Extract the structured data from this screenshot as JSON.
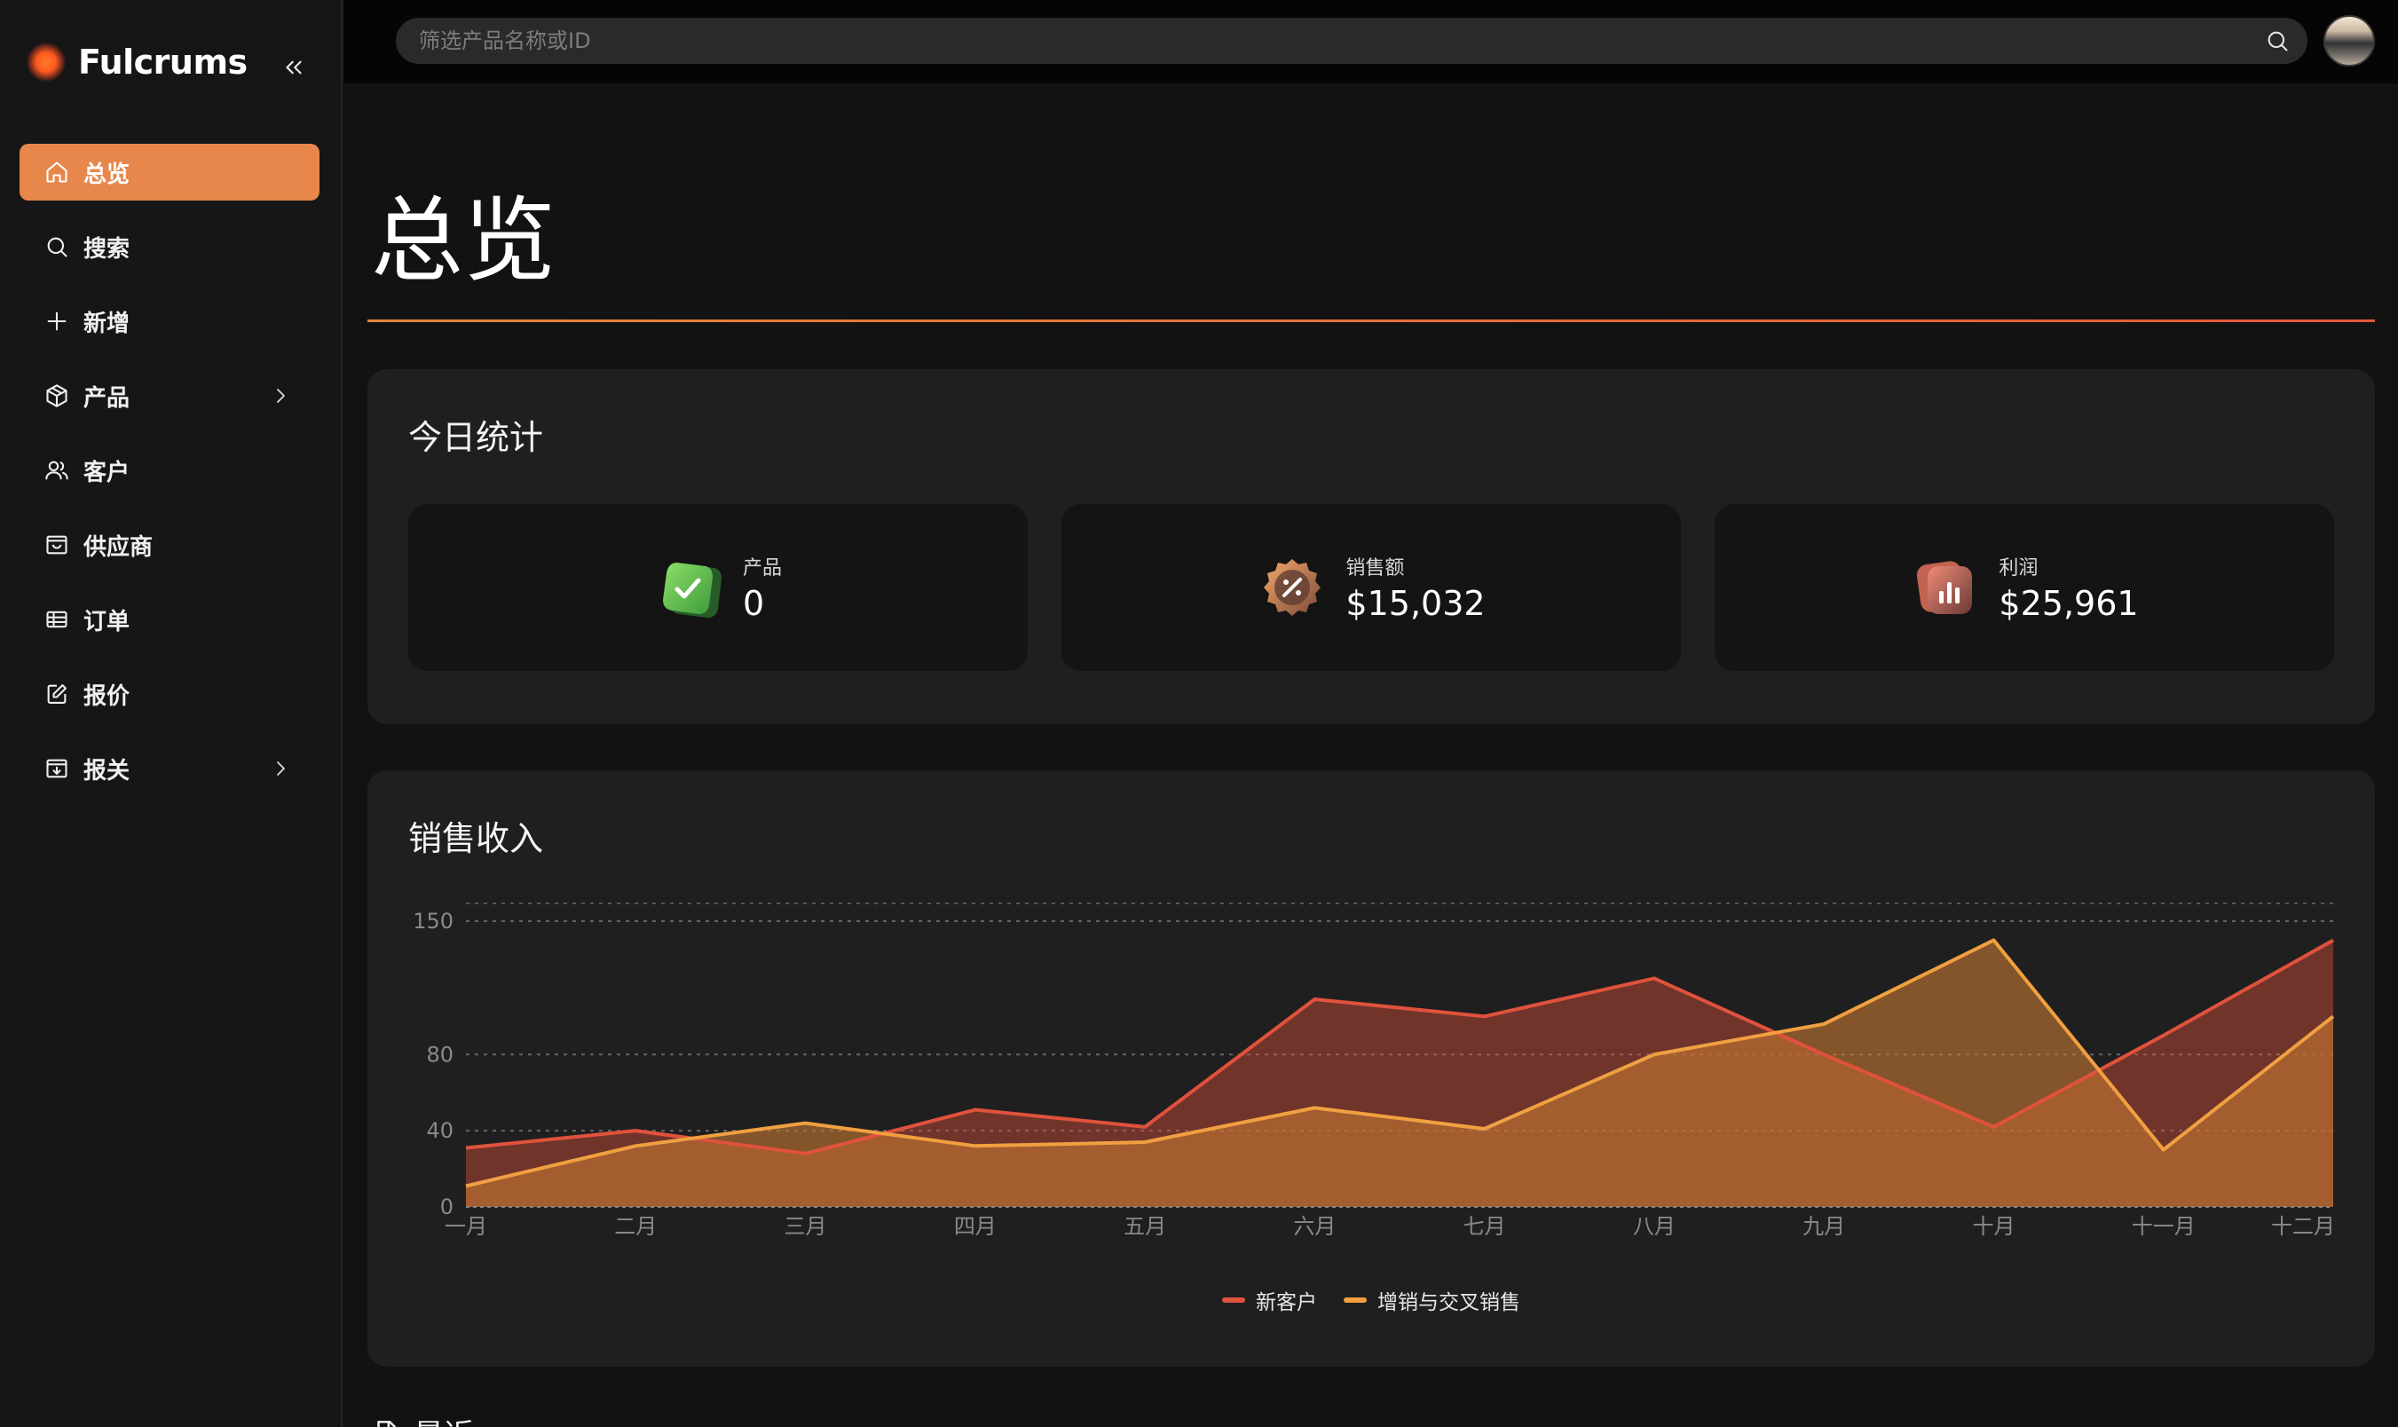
{
  "app": {
    "brand": "Fulcrums",
    "accent": "#e8874b"
  },
  "sidebar": {
    "items": [
      {
        "label": "总览",
        "icon": "home-icon",
        "active": true
      },
      {
        "label": "搜索",
        "icon": "search-icon"
      },
      {
        "label": "新增",
        "icon": "plus-icon"
      },
      {
        "label": "产品",
        "icon": "package-icon",
        "has_submenu": true
      },
      {
        "label": "客户",
        "icon": "users-icon"
      },
      {
        "label": "供应商",
        "icon": "inbox-icon"
      },
      {
        "label": "订单",
        "icon": "table-icon"
      },
      {
        "label": "报价",
        "icon": "edit-icon"
      },
      {
        "label": "报关",
        "icon": "archive-icon",
        "has_submenu": true
      }
    ]
  },
  "search": {
    "placeholder": "筛选产品名称或ID"
  },
  "page": {
    "title": "总览",
    "recent_label": "最近"
  },
  "stats": {
    "title": "今日统计",
    "items": [
      {
        "label": "产品",
        "value": "0",
        "icon": "shield-check-icon",
        "color": "#5fbf4f"
      },
      {
        "label": "销售额",
        "value": "$15,032",
        "icon": "discount-badge-icon",
        "color": "#e8874b"
      },
      {
        "label": "利润",
        "value": "$25,961",
        "icon": "bar-chart-icon",
        "color": "#e0705a"
      }
    ]
  },
  "chart_data": {
    "type": "area",
    "title": "销售收入",
    "categories": [
      "一月",
      "二月",
      "三月",
      "四月",
      "五月",
      "六月",
      "七月",
      "八月",
      "九月",
      "十月",
      "十一月",
      "十二月"
    ],
    "yticks": [
      0,
      40,
      80,
      150
    ],
    "ylim": [
      0,
      150
    ],
    "grid": true,
    "legend_position": "bottom-center",
    "series": [
      {
        "name": "新客户",
        "color": "#e0523c",
        "values": [
          31,
          40,
          28,
          51,
          42,
          109,
          100,
          120,
          80,
          42,
          90,
          140
        ]
      },
      {
        "name": "增销与交叉销售",
        "color": "#f0a040",
        "values": [
          11,
          32,
          44,
          32,
          34,
          52,
          41,
          80,
          96,
          140,
          30,
          100
        ]
      }
    ]
  }
}
